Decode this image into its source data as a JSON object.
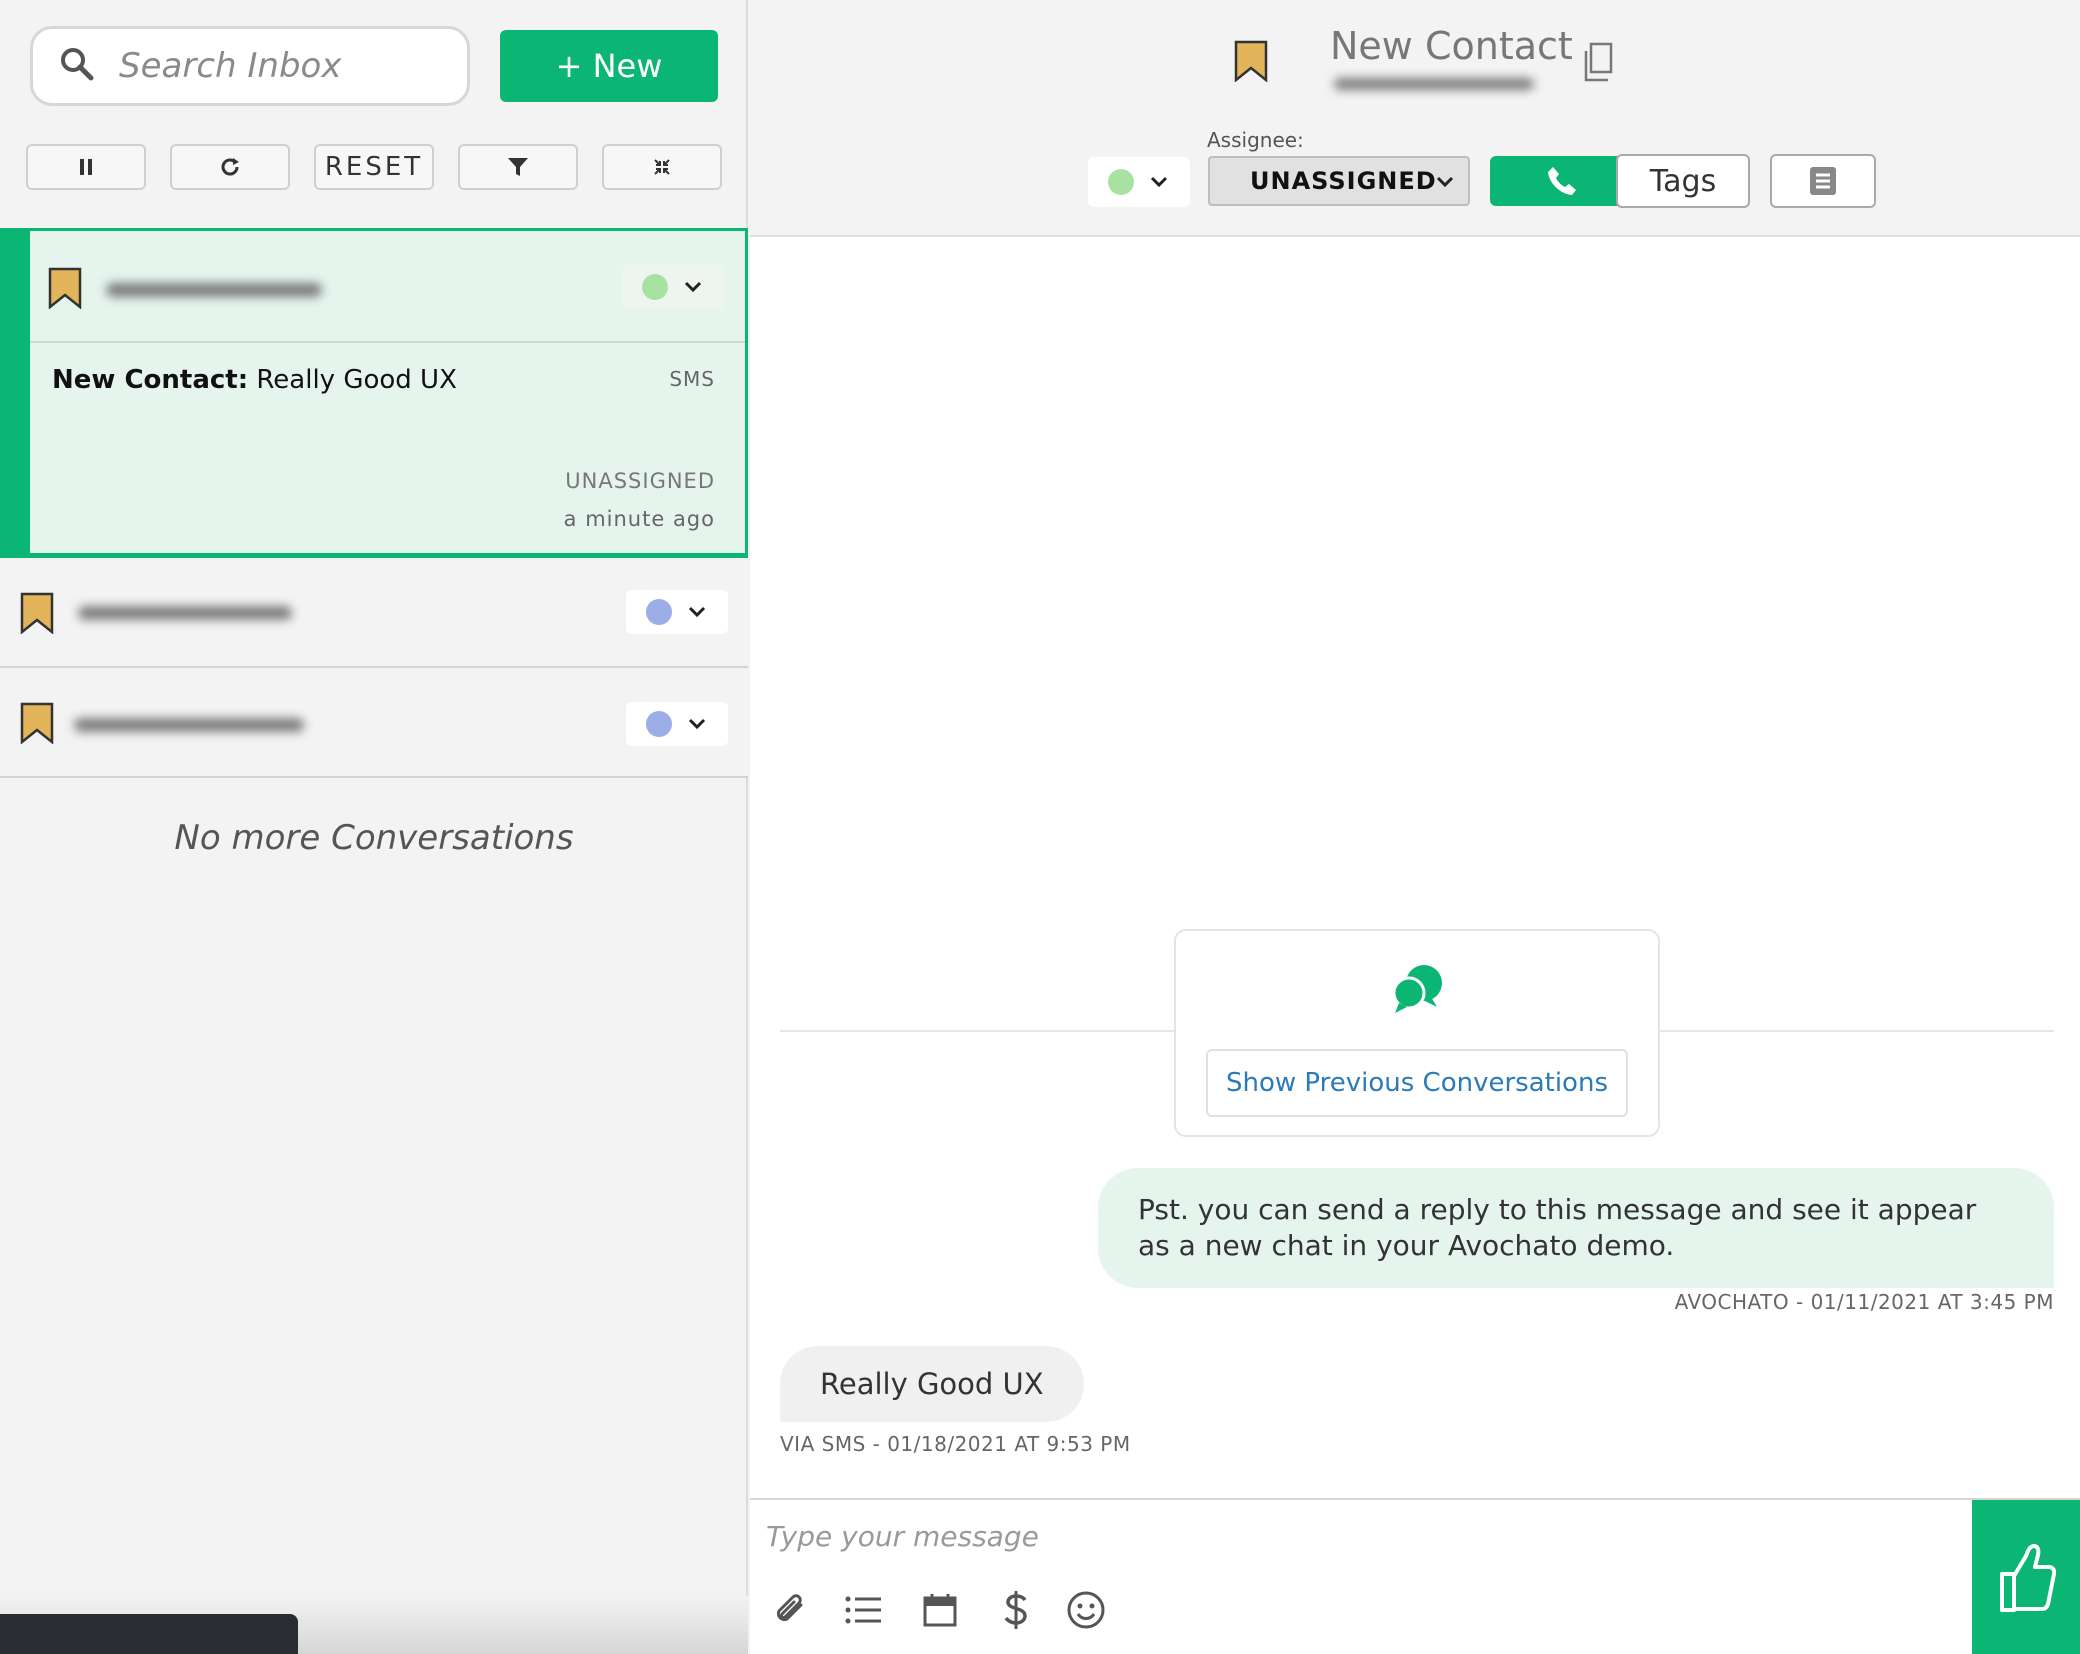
{
  "sidebar": {
    "search_placeholder": "Search Inbox",
    "new_button": "+ New",
    "toolbar": {
      "pause_icon": "pause-icon",
      "refresh_icon": "refresh-icon",
      "reset_label": "RESET",
      "filter_icon": "filter-icon",
      "compress_icon": "compress-icon"
    },
    "active_conversation": {
      "title_prefix": "New Contact:",
      "title_text": "Really Good UX",
      "channel": "SMS",
      "assignee": "UNASSIGNED",
      "time": "a minute ago",
      "status_color": "#a8e2a3"
    },
    "other_conversations": [
      {
        "status_color": "#9baee8"
      },
      {
        "status_color": "#9baee8"
      }
    ],
    "empty_text": "No more Conversations"
  },
  "conversation": {
    "contact_name": "New Contact",
    "status_color": "#a8e2a3",
    "assignee_label": "Assignee:",
    "assignee_value": "UNASSIGNED",
    "tags_button": "Tags",
    "show_previous": "Show Previous Conversations",
    "messages": [
      {
        "direction": "outgoing",
        "text": "Pst. you can send a reply to this message and see it appear as a new chat in your Avochato demo.",
        "meta": "AVOCHATO - 01/11/2021 AT 3:45 PM"
      },
      {
        "direction": "incoming",
        "text": "Really Good UX",
        "meta": "VIA SMS - 01/18/2021 AT 9:53 PM"
      }
    ],
    "composer_placeholder": "Type your message"
  },
  "colors": {
    "accent": "#0bb574",
    "bookmark": "#e3b55a",
    "link": "#2b7bb9"
  }
}
